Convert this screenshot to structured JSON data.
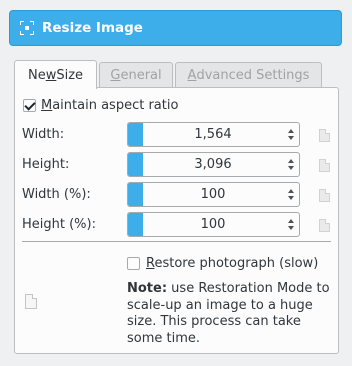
{
  "header": {
    "title": "Resize Image",
    "icon": "resize-icon"
  },
  "tabs": [
    {
      "label": "New Size",
      "accel": "w",
      "pre": "Ne",
      "post": " Size",
      "active": true
    },
    {
      "label": "General",
      "accel": "G",
      "pre": "",
      "post": "eneral",
      "active": false
    },
    {
      "label": "Advanced Settings",
      "accel": "A",
      "pre": "",
      "post": "dvanced Settings",
      "active": false
    }
  ],
  "aspect": {
    "label_accel": "M",
    "label_rest": "aintain aspect ratio",
    "checked": true
  },
  "fields": [
    {
      "label": "Width:",
      "value": "1,564"
    },
    {
      "label": "Height:",
      "value": "3,096"
    },
    {
      "label": "Width (%):",
      "value": "100"
    },
    {
      "label": "Height (%):",
      "value": "100"
    }
  ],
  "restore": {
    "label_accel": "R",
    "label_rest": "estore photograph (slow)",
    "checked": false
  },
  "note": {
    "bold": "Note:",
    "text": " use Restoration Mode to scale-up an image to a huge size. This process can take some time."
  },
  "colors": {
    "accent": "#3daee9",
    "background": "#eff0f1",
    "panel": "#fcfcfc"
  }
}
